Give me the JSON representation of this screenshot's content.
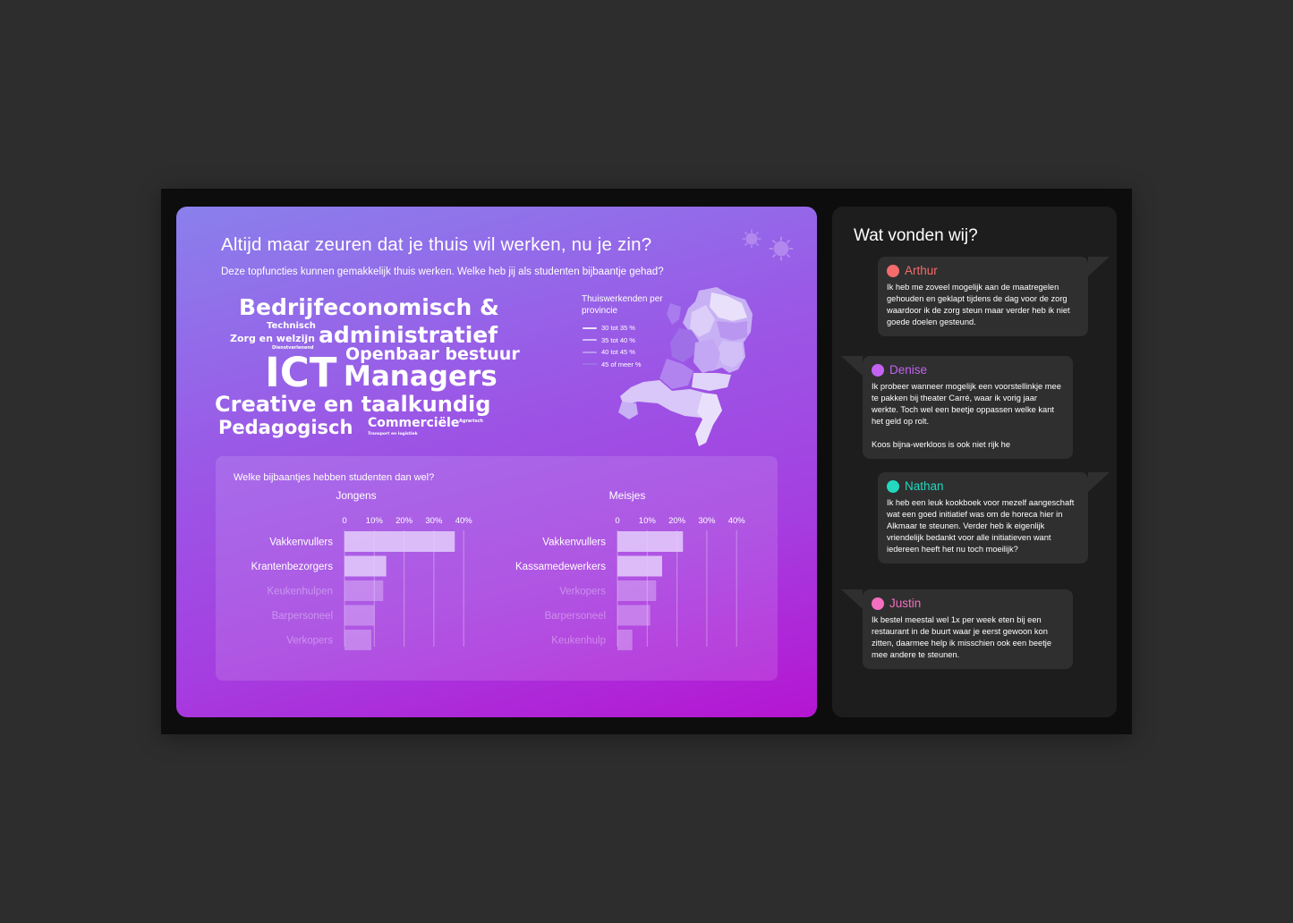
{
  "left_panel": {
    "headline": "Altijd maar zeuren dat je thuis wil werken, nu je zin?",
    "subline": "Deze topfuncties kunnen gemakkelijk thuis werken. Welke heb jij als studenten bijbaantje gehad?",
    "word_cloud": {
      "w1": "Bedrijfeconomisch &",
      "w2": "Technisch",
      "w3": "Zorg en welzijn",
      "w4": "administratief",
      "w5": "Dienstverlenend",
      "w6": "Openbaar bestuur",
      "w7": "ICT",
      "w8": "Managers",
      "w9": "Creative en taalkundig",
      "w10": "Pedagogisch",
      "w11": "Commerciële",
      "w12": "Agrarisch",
      "w13": "Transport en logistiek"
    },
    "map_legend": {
      "title": "Thuiswerkenden per provincie",
      "items": [
        {
          "label": "30 tot 35 %",
          "color": "#e9e1fb"
        },
        {
          "label": "35 tot 40 %",
          "color": "#d2bff7"
        },
        {
          "label": "40 tot 45 %",
          "color": "#b996f0"
        },
        {
          "label": "45 of meer %",
          "color": "#9f6fe8"
        }
      ]
    },
    "chart_question": "Welke bijbaantjes hebben studenten dan wel?"
  },
  "chart_data": [
    {
      "type": "bar",
      "title": "Jongens",
      "categories": [
        "Vakkenvullers",
        "Krantenbezorgers",
        "Keukenhulpen",
        "Barpersoneel",
        "Verkopers"
      ],
      "values": [
        37,
        14,
        13,
        10,
        9
      ],
      "xlim": [
        0,
        40
      ],
      "xticks": [
        "0",
        "10%",
        "20%",
        "30%",
        "40%"
      ]
    },
    {
      "type": "bar",
      "title": "Meisjes",
      "categories": [
        "Vakkenvullers",
        "Kassamedewerkers",
        "Verkopers",
        "Barpersoneel",
        "Keukenhulp"
      ],
      "values": [
        22,
        15,
        13,
        11,
        5
      ],
      "xlim": [
        0,
        40
      ],
      "xticks": [
        "0",
        "10%",
        "20%",
        "30%",
        "40%"
      ]
    }
  ],
  "right_panel": {
    "title": "Wat vonden wij?",
    "comments": [
      {
        "name": "Arthur",
        "color": "#f56b6b",
        "text": "Ik heb me zoveel mogelijk aan de maatregelen gehouden en geklapt tijdens de dag voor de zorg waardoor ik de zorg steun maar verder heb ik niet goede doelen gesteund."
      },
      {
        "name": "Denise",
        "color": "#c462f2",
        "text": "Ik probeer wanneer mogelijk een voorstellinkje mee te pakken bij theater Carré, waar ik vorig jaar werkte. Toch wel een beetje oppassen welke kant het geld op rolt.\n\nKoos bijna-werkloos is ook niet rijk he"
      },
      {
        "name": "Nathan",
        "color": "#22d8bf",
        "text": "Ik heb een leuk kookboek voor mezelf aangeschaft wat een goed initiatief was om de horeca hier in Alkmaar te steunen. Verder heb ik eigenlijk vriendelijk bedankt voor alle initiatieven want iedereen heeft het nu toch moeilijk?"
      },
      {
        "name": "Justin",
        "color": "#f46fc0",
        "text": "Ik bestel meestal wel 1x per week eten bij een restaurant in de buurt waar je eerst gewoon kon zitten, daarmee help ik misschien ook een beetje mee andere te steunen."
      }
    ]
  }
}
